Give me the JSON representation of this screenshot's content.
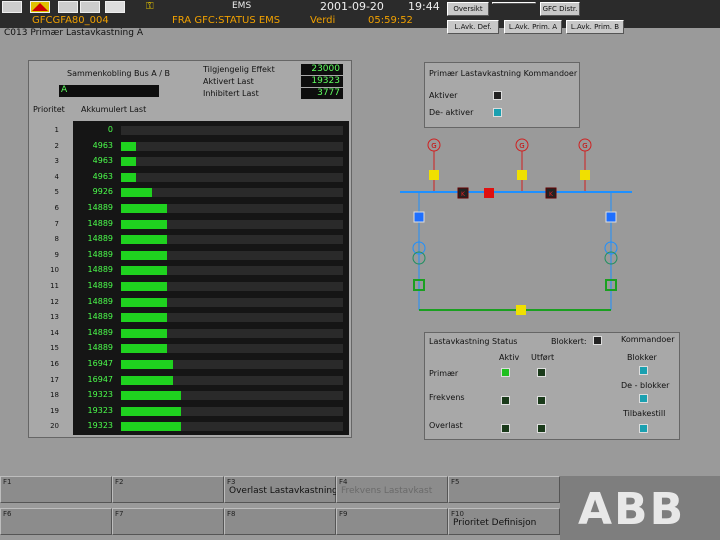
{
  "topbar": {
    "station_code": "GFCGFA80_004",
    "app_name": "EMS",
    "source": "FRA GFC:STATUS EMS",
    "value_label": "Verdi",
    "date": "2001-09-20",
    "time_short": "19:44",
    "time_seconds": "05:59:52",
    "buttons": {
      "oversikt": "Oversikt",
      "gfc_distr": "GFC Distr.",
      "lavk_def": "L.Avk. Def.",
      "lavk_prim_a": "L.Avk. Prim. A",
      "lavk_prim_b": "L.Avk. Prim. B"
    }
  },
  "subtitle": "C013 Primær Lastavkastning A",
  "left_panel": {
    "sammenkobling_label": "Sammenkobling Bus A / B",
    "bus_value": "A",
    "tilgjengelig_label": "Tilgjengelig Effekt",
    "tilgjengelig_value": "23000",
    "aktivert_label": "Aktivert Last",
    "aktivert_value": "19323",
    "inhibitert_label": "Inhibitert Last",
    "inhibitert_value": "3777",
    "col_prioritet": "Prioritet",
    "col_akkumulert": "Akkumulert Last",
    "bar_max": 23000,
    "rows": [
      {
        "prio": "1",
        "value": "0",
        "level": 0
      },
      {
        "prio": "2",
        "value": "4963",
        "level": 4963
      },
      {
        "prio": "3",
        "value": "4963",
        "level": 4963
      },
      {
        "prio": "4",
        "value": "4963",
        "level": 4963
      },
      {
        "prio": "5",
        "value": "9926",
        "level": 9926
      },
      {
        "prio": "6",
        "value": "14889",
        "level": 14889
      },
      {
        "prio": "7",
        "value": "14889",
        "level": 14889
      },
      {
        "prio": "8",
        "value": "14889",
        "level": 14889
      },
      {
        "prio": "9",
        "value": "14889",
        "level": 14889
      },
      {
        "prio": "10",
        "value": "14889",
        "level": 14889
      },
      {
        "prio": "11",
        "value": "14889",
        "level": 14889
      },
      {
        "prio": "12",
        "value": "14889",
        "level": 14889
      },
      {
        "prio": "13",
        "value": "14889",
        "level": 14889
      },
      {
        "prio": "14",
        "value": "14889",
        "level": 14889
      },
      {
        "prio": "15",
        "value": "14889",
        "level": 14889
      },
      {
        "prio": "16",
        "value": "16947",
        "level": 16947
      },
      {
        "prio": "17",
        "value": "16947",
        "level": 16947
      },
      {
        "prio": "18",
        "value": "19323",
        "level": 19323
      },
      {
        "prio": "19",
        "value": "19323",
        "level": 19323
      },
      {
        "prio": "20",
        "value": "19323",
        "level": 19323
      }
    ]
  },
  "command_panel": {
    "title": "Primær Lastavkastning Kommandoer",
    "aktiver": "Aktiver",
    "deaktiver": "De- aktiver"
  },
  "diagram": {
    "gen_label": "G",
    "breaker_label": "K"
  },
  "status_panel": {
    "title": "Lastavkastning Status",
    "blokkert": "Blokkert:",
    "kommandoer": "Kommandoer",
    "col_aktiv": "Aktiv",
    "col_utfort": "Utført",
    "row_primaer": "Primær",
    "row_frekvens": "Frekvens",
    "row_overlast": "Overlast",
    "cmd_blokker": "Blokker",
    "cmd_deblokker": "De - blokker",
    "cmd_tilbakestill": "Tilbakestill"
  },
  "fkeys": {
    "f1": "F1",
    "f2": "F2",
    "f3": "F3",
    "f3_label": "Overlast Lastavkastning",
    "f4": "F4",
    "f4_label": "Frekvens Lastavkast",
    "f5": "F5",
    "f6": "F6",
    "f7": "F7",
    "f8": "F8",
    "f9": "F9",
    "f10": "F10",
    "f10_label": "Prioritet Definisjon"
  },
  "logo": {
    "text": "ABB"
  },
  "colors": {
    "bar_green": "#1fd21f",
    "digit_green": "#4cff4c",
    "busbar_blue": "#1e90ff",
    "breaker_red": "#e01010",
    "breaker_yellow": "#f0e000",
    "alarm_yellow": "#f0a000"
  }
}
